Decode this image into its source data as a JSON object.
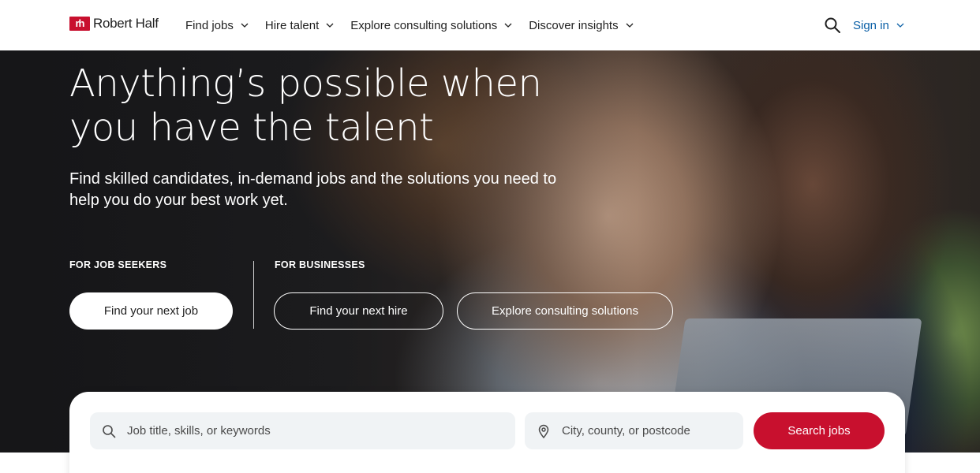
{
  "header": {
    "logo_mark": "rh",
    "logo_text": "Robert Half",
    "nav": [
      {
        "label": "Find jobs",
        "icon": "chevron-down-icon"
      },
      {
        "label": "Hire talent",
        "icon": "chevron-down-icon"
      },
      {
        "label": "Explore consulting solutions",
        "icon": "chevron-down-icon"
      },
      {
        "label": "Discover insights",
        "icon": "chevron-down-icon"
      }
    ],
    "search_icon": "search-icon",
    "signin_label": "Sign in"
  },
  "hero": {
    "headline": "Anything’s possible when you have the talent",
    "subline": "Find skilled candidates, in-demand jobs and the solutions you need to help you do your best work yet.",
    "job_seekers_label": "FOR JOB SEEKERS",
    "businesses_label": "FOR BUSINESSES",
    "find_job_label": "Find your next job",
    "find_hire_label": "Find your next hire",
    "explore_label": "Explore consulting solutions"
  },
  "search": {
    "keywords_placeholder": "Job title, skills, or keywords",
    "location_placeholder": "City, county, or postcode",
    "button_label": "Search jobs"
  },
  "colors": {
    "brand": "#c8102e",
    "link": "#0a5fa6",
    "field_bg": "#f0f3f5"
  }
}
